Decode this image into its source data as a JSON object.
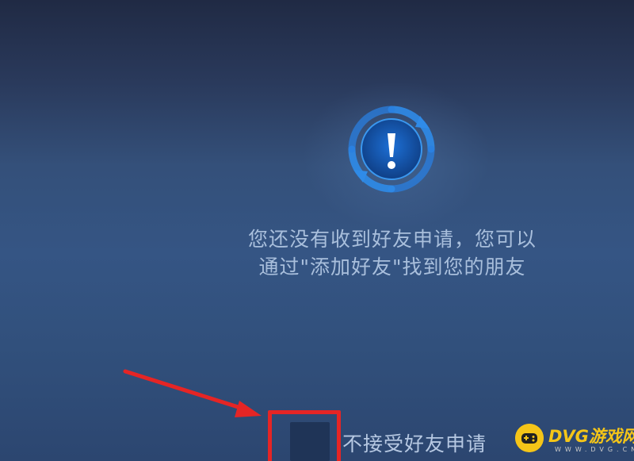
{
  "empty_state": {
    "icon": "exclamation-alert-icon",
    "line1": "您还没有收到好友申请，您可以",
    "line2": "通过\"添加好友\"找到您的朋友"
  },
  "option": {
    "checkbox_label": "不接受好友申请",
    "checked": false
  },
  "annotation": {
    "arrow_color": "#e52525",
    "box_color": "#e52525"
  },
  "watermark": {
    "title": "DVG游戏网",
    "subtitle": "WWW.DVG.CN",
    "color": "#f5c518"
  },
  "colors": {
    "text": "#a9bfdc",
    "icon_ring": "#2f8be8",
    "checkbox_fill": "#1f3457"
  }
}
